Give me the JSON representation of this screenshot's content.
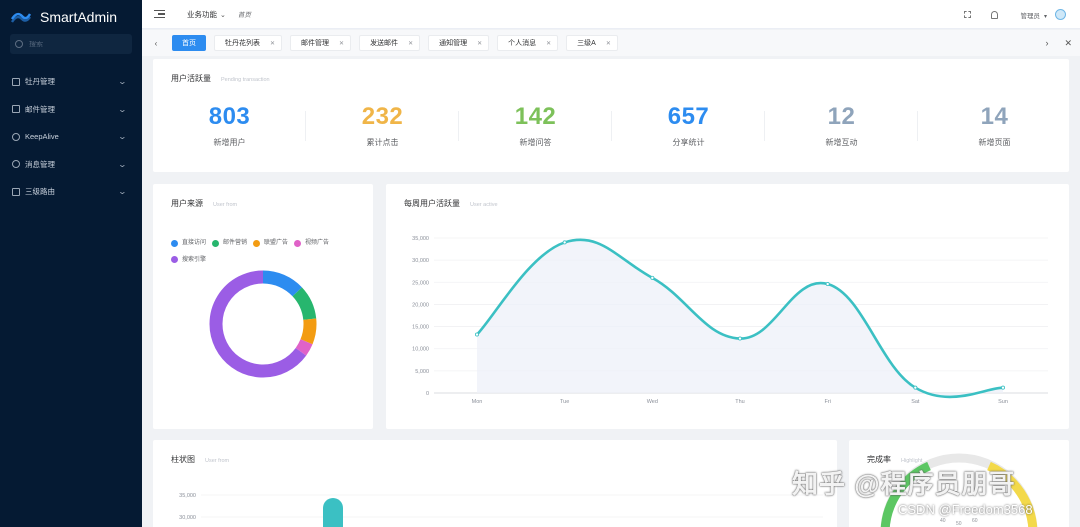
{
  "brand": {
    "name": "SmartAdmin"
  },
  "sidebar": {
    "search_placeholder": "搜索",
    "items": [
      {
        "label": "牡丹管理",
        "icon": "mail-icon"
      },
      {
        "label": "邮件管理",
        "icon": "mail-icon"
      },
      {
        "label": "KeepAlive",
        "icon": "gear-icon"
      },
      {
        "label": "消息管理",
        "icon": "bell-icon"
      },
      {
        "label": "三级路由",
        "icon": "home-icon"
      }
    ]
  },
  "topbar": {
    "business_menu": "业务功能",
    "breadcrumb": "首页",
    "user": "管理员"
  },
  "tabs": [
    {
      "label": "首页",
      "active": true
    },
    {
      "label": "牡丹花列表"
    },
    {
      "label": "邮件管理"
    },
    {
      "label": "发送邮件"
    },
    {
      "label": "通知管理"
    },
    {
      "label": "个人消息"
    },
    {
      "label": "三级A"
    }
  ],
  "stats_card": {
    "title": "用户活跃量",
    "subtitle": "Pending transaction",
    "items": [
      {
        "value": "803",
        "label": "新增用户",
        "color": "#2d8cf0"
      },
      {
        "value": "232",
        "label": "累计点击",
        "color": "#f0b548"
      },
      {
        "value": "142",
        "label": "新增问答",
        "color": "#7dc15a"
      },
      {
        "value": "657",
        "label": "分享统计",
        "color": "#2d8cf0"
      },
      {
        "value": "12",
        "label": "新增互动",
        "color": "#8fa4bb"
      },
      {
        "value": "14",
        "label": "新增页面",
        "color": "#8fa4bb"
      }
    ]
  },
  "source_card": {
    "title": "用户来源",
    "subtitle": "User from",
    "chart_data": {
      "type": "pie",
      "donut": true,
      "legend": [
        {
          "name": "直接访问",
          "color": "#2d8cf0"
        },
        {
          "name": "邮件营销",
          "color": "#27b66e"
        },
        {
          "name": "联盟广告",
          "color": "#f39c12"
        },
        {
          "name": "视频广告",
          "color": "#e062c8"
        },
        {
          "name": "搜索引擎",
          "color": "#9b5de5"
        }
      ],
      "values": [
        1000,
        800,
        600,
        300,
        5000
      ],
      "legend_position": "top"
    }
  },
  "weekly_card": {
    "title": "每周用户活跃量",
    "subtitle": "User active",
    "chart_data": {
      "type": "line",
      "smooth": true,
      "area": true,
      "categories": [
        "Mon",
        "Tue",
        "Wed",
        "Thu",
        "Fri",
        "Sat",
        "Sun"
      ],
      "values": [
        13200,
        34000,
        26000,
        12300,
        24600,
        1200,
        1200
      ],
      "yticks": [
        "0",
        "5,000",
        "10,000",
        "15,000",
        "20,000",
        "25,000",
        "30,000",
        "35,000"
      ],
      "ylim": [
        0,
        35000
      ],
      "color": "#3bc0c3",
      "grid": true
    }
  },
  "bar_card": {
    "title": "柱状图",
    "subtitle": "User from",
    "chart_data": {
      "type": "bar",
      "yticks": [
        "35,000",
        "30,000"
      ],
      "ylim": [
        0,
        35000
      ],
      "color": "#3bc0c3",
      "values": [
        35000
      ]
    }
  },
  "done_card": {
    "title": "完成率",
    "subtitle": "Highlight",
    "gauge_ticks": [
      "40",
      "50",
      "60"
    ]
  },
  "watermark": {
    "line1": "知乎 @程序员朋哥",
    "line2": "CSDN @Freedom3568"
  }
}
